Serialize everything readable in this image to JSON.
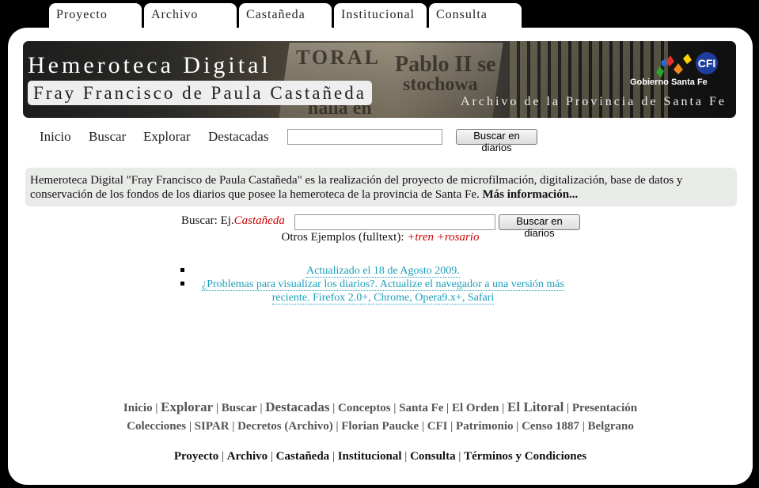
{
  "tabs": [
    "Proyecto",
    "Archivo",
    "Castañeda",
    "Institucional",
    "Consulta"
  ],
  "banner": {
    "title": "Hemeroteca Digital",
    "subtitle": "Fray Francisco de Paula Castañeda",
    "archive": "Archivo de la Provincia de Santa Fe",
    "gov_label": "Gobierno Santa Fe",
    "cfi_label": "CFI",
    "paper_text": [
      "TORAL",
      "Pablo II se",
      "stochowa",
      "halla en"
    ]
  },
  "nav": {
    "items": [
      "Inicio",
      "Buscar",
      "Explorar",
      "Destacadas"
    ],
    "search_value": "",
    "search_button": "Buscar en diarios"
  },
  "info": {
    "text": "Hemeroteca Digital \"Fray Francisco de Paula Castañeda\" es la realización del proyecto de microfilmación, digitalización, base de datos y conservación de los fondos de los diarios que posee la hemeroteca de la provincia de Santa Fe.",
    "more": "Más información..."
  },
  "search": {
    "label": "Buscar: Ej.",
    "example": "Castañeda",
    "value": "",
    "button": "Buscar en diarios",
    "other_label": "Otros Ejemplos (fulltext):",
    "other_example": "+tren +rosario"
  },
  "bullets": [
    "Actualizado el 18 de Agosto 2009.",
    "¿Problemas para visualizar los diarios?. Actualize el navegador a una versión más reciente. Firefox 2.0+, Chrome, Opera9.x+, Safari"
  ],
  "footer": {
    "row1": [
      {
        "label": "Inicio",
        "big": false
      },
      {
        "label": "Explorar",
        "big": true
      },
      {
        "label": "Buscar",
        "big": false
      },
      {
        "label": "Destacadas",
        "big": true
      },
      {
        "label": "Conceptos",
        "big": false
      },
      {
        "label": "Santa Fe",
        "big": false
      },
      {
        "label": "El Orden",
        "big": false
      },
      {
        "label": "El Litoral",
        "big": true
      },
      {
        "label": "Presentación",
        "big": false
      }
    ],
    "row2": [
      "Colecciones",
      "SIPAR",
      "Decretos (Archivo)",
      "Florian Paucke",
      "CFI",
      "Patrimonio",
      "Censo 1887",
      "Belgrano"
    ],
    "row3": [
      "Proyecto",
      "Archivo",
      "Castañeda",
      "Institucional",
      "Consulta",
      "Términos y Condiciones"
    ],
    "separator": "|"
  }
}
